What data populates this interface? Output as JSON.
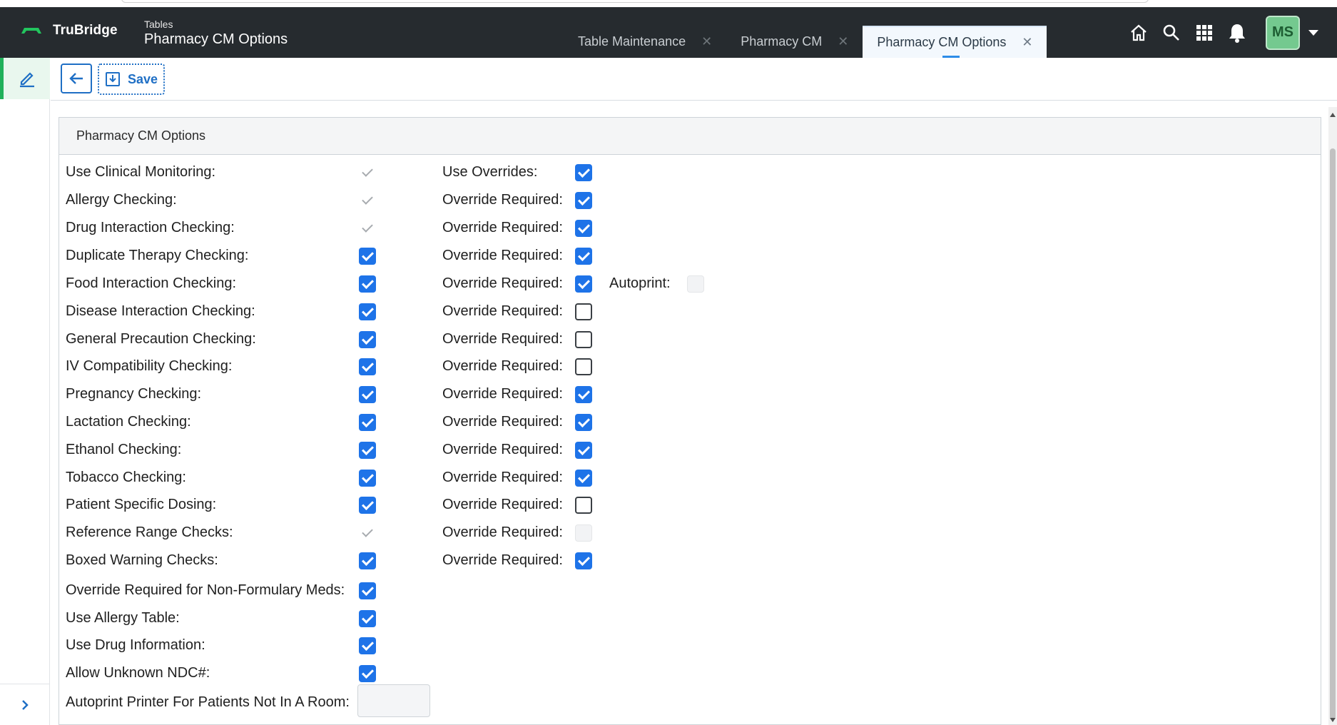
{
  "brand": {
    "name": "TruBridge"
  },
  "breadcrumb": {
    "section": "Tables",
    "title": "Pharmacy CM Options"
  },
  "tabs": [
    {
      "label": "Table Maintenance",
      "active": false
    },
    {
      "label": "Pharmacy CM",
      "active": false
    },
    {
      "label": "Pharmacy CM Options",
      "active": true
    }
  ],
  "header_icons": [
    "home-icon",
    "search-icon",
    "apps-grid-icon",
    "bell-icon"
  ],
  "user": {
    "initials": "MS"
  },
  "toolbar": {
    "back_icon": "arrow-left-icon",
    "save_label": "Save",
    "save_icon": "save-icon"
  },
  "panel": {
    "title": "Pharmacy CM Options",
    "rows": [
      {
        "label": "Use Clinical Monitoring:",
        "state": "disabled-checked",
        "pair_label": "Use Overrides:",
        "pair_state": "checked"
      },
      {
        "label": "Allergy Checking:",
        "state": "disabled-checked",
        "pair_label": "Override Required:",
        "pair_state": "checked"
      },
      {
        "label": "Drug Interaction Checking:",
        "state": "disabled-checked",
        "pair_label": "Override Required:",
        "pair_state": "checked"
      },
      {
        "label": "Duplicate Therapy Checking:",
        "state": "checked",
        "pair_label": "Override Required:",
        "pair_state": "checked"
      },
      {
        "label": "Food Interaction Checking:",
        "state": "checked",
        "pair_label": "Override Required:",
        "pair_state": "checked",
        "extra_label": "Autoprint:",
        "extra_state": "disabled-unchecked"
      },
      {
        "label": "Disease Interaction Checking:",
        "state": "checked",
        "pair_label": "Override Required:",
        "pair_state": "unchecked"
      },
      {
        "label": "General Precaution Checking:",
        "state": "checked",
        "pair_label": "Override Required:",
        "pair_state": "unchecked"
      },
      {
        "label": "IV Compatibility Checking:",
        "state": "checked",
        "pair_label": "Override Required:",
        "pair_state": "unchecked"
      },
      {
        "label": "Pregnancy Checking:",
        "state": "checked",
        "pair_label": "Override Required:",
        "pair_state": "checked"
      },
      {
        "label": "Lactation Checking:",
        "state": "checked",
        "pair_label": "Override Required:",
        "pair_state": "checked"
      },
      {
        "label": "Ethanol Checking:",
        "state": "checked",
        "pair_label": "Override Required:",
        "pair_state": "checked"
      },
      {
        "label": "Tobacco Checking:",
        "state": "checked",
        "pair_label": "Override Required:",
        "pair_state": "checked"
      },
      {
        "label": "Patient Specific Dosing:",
        "state": "checked",
        "pair_label": "Override Required:",
        "pair_state": "unchecked"
      },
      {
        "label": "Reference Range Checks:",
        "state": "disabled-checked",
        "pair_label": "Override Required:",
        "pair_state": "disabled-unchecked"
      },
      {
        "label": "Boxed Warning Checks:",
        "state": "checked",
        "pair_label": "Override Required:",
        "pair_state": "checked"
      },
      {
        "label": "Override Required for Non-Formulary Meds:",
        "state": "checked"
      },
      {
        "label": "Use Allergy Table:",
        "state": "checked"
      },
      {
        "label": "Use Drug Information:",
        "state": "checked"
      },
      {
        "label": "Allow Unknown NDC#:",
        "state": "checked"
      }
    ],
    "printer": {
      "label": "Autoprint Printer For Patients Not In A Room:",
      "value": ""
    }
  },
  "rail": {
    "edit_icon": "pencil-icon",
    "expand_icon": "chevron-right-icon"
  },
  "colors": {
    "header_bg": "#262b2f",
    "accent": "#1e73e8",
    "brand_green": "#20b15a"
  }
}
